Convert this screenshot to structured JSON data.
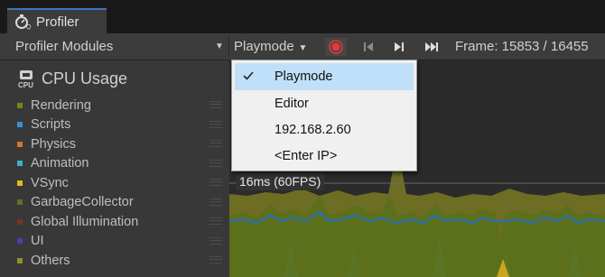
{
  "window": {
    "tab_title": "Profiler",
    "tab_icon": "profiler-icon"
  },
  "toolbar": {
    "modules_label": "Profiler Modules",
    "target_label": "Playmode",
    "record_color": "#e5383b",
    "frame_label": "Frame: 15853 / 16455"
  },
  "cpu": {
    "title": "CPU Usage",
    "categories": [
      {
        "label": "Rendering",
        "color": "#6d8a1f"
      },
      {
        "label": "Scripts",
        "color": "#3f8fcf"
      },
      {
        "label": "Physics",
        "color": "#d1762a"
      },
      {
        "label": "Animation",
        "color": "#3fb0c8"
      },
      {
        "label": "VSync",
        "color": "#e3b924"
      },
      {
        "label": "GarbageCollector",
        "color": "#6b6b2a"
      },
      {
        "label": "Global Illumination",
        "color": "#7a3020"
      },
      {
        "label": "UI",
        "color": "#4a3fb0"
      },
      {
        "label": "Others",
        "color": "#8f8f2a"
      }
    ]
  },
  "chart": {
    "fps_label": "16ms (60FPS)"
  },
  "dropdown": {
    "items": [
      {
        "label": "Playmode",
        "selected": true
      },
      {
        "label": "Editor",
        "selected": false
      },
      {
        "label": "192.168.2.60",
        "selected": false
      },
      {
        "label": "<Enter IP>",
        "selected": false
      }
    ]
  }
}
